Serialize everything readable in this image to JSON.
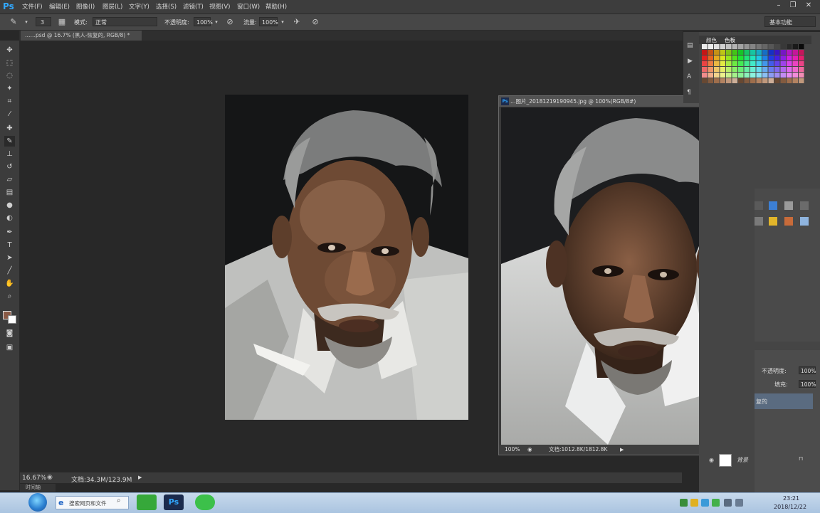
{
  "app": {
    "logo": "Ps"
  },
  "menu": [
    "文件(F)",
    "编辑(E)",
    "图像(I)",
    "图层(L)",
    "文字(Y)",
    "选择(S)",
    "滤镜(T)",
    "视图(V)",
    "窗口(W)",
    "帮助(H)"
  ],
  "window_controls": {
    "minimize": "–",
    "restore": "❐",
    "close": "✕"
  },
  "options": {
    "mode_label": "模式:",
    "mode_value": "正常",
    "opacity_label": "不透明度:",
    "opacity_value": "100%",
    "flow_label": "流量:",
    "flow_value": "100%",
    "brush_size": "3",
    "workspace": "基本功能"
  },
  "document": {
    "tab_title": "……psd @ 16.7% (黑人-恢复的, RGB/8) *",
    "zoom": "16.67%",
    "doc_size": "文档:34.3M/123.9M",
    "mini_bridge": "时间轴"
  },
  "reference": {
    "title": "…图片_20181219190945.jpg @ 100%(RGB/8#)",
    "zoom": "100%",
    "doc_size": "文档:1012.8K/1812.8K"
  },
  "panels": {
    "tab_color": "颜色",
    "tab_swatches": "色板",
    "layers": {
      "opacity_label": "不透明度:",
      "opacity_value": "100%",
      "fill_label": "填充:",
      "fill_value": "100%",
      "selected_layer": "复的",
      "background_layer": "背景"
    }
  },
  "taskbar": {
    "search_placeholder": "搜索网页和文件",
    "ps_label": "Ps",
    "time": "23:21",
    "date": "2018/12/22"
  },
  "colors": {
    "foreground": "#8a5a46",
    "background": "#ffffff",
    "ps_blue": "#31a8ff"
  },
  "icons": {
    "tools": [
      "move-icon",
      "marquee-icon",
      "lasso-icon",
      "magic-wand-icon",
      "crop-icon",
      "eyedropper-icon",
      "healing-icon",
      "brush-icon",
      "stamp-icon",
      "history-brush-icon",
      "eraser-icon",
      "gradient-icon",
      "blur-icon",
      "dodge-icon",
      "pen-icon",
      "type-icon",
      "path-select-icon",
      "shape-icon",
      "hand-icon",
      "zoom-icon"
    ]
  }
}
